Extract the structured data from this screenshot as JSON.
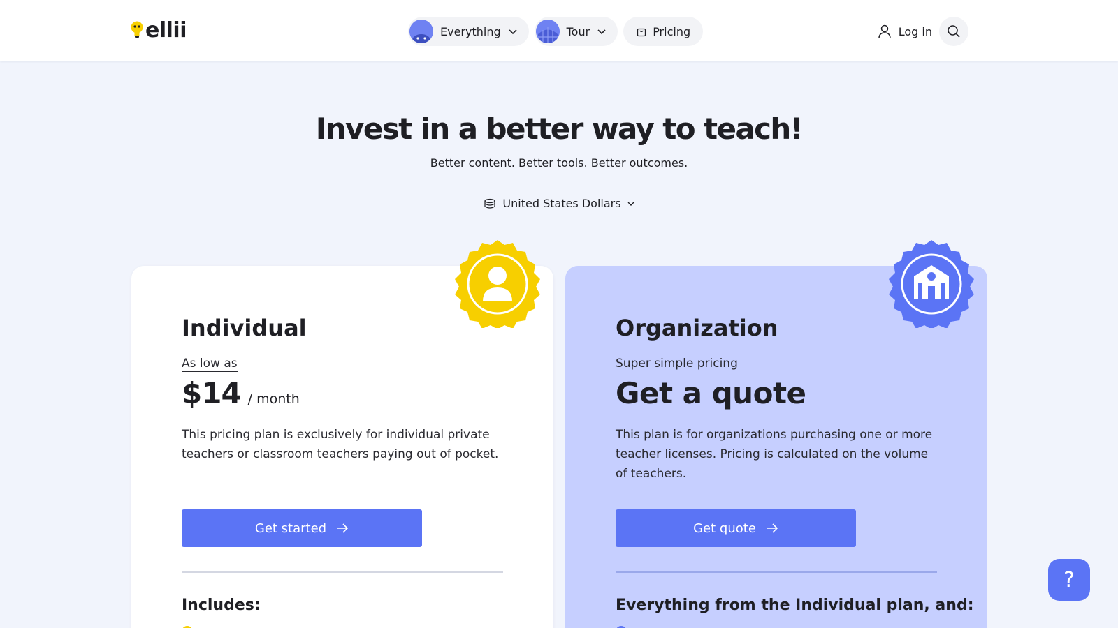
{
  "header": {
    "logo_text": "ellii",
    "nav": [
      {
        "label": "Everything"
      },
      {
        "label": "Tour"
      },
      {
        "label": "Pricing"
      }
    ],
    "login_label": "Log in"
  },
  "hero": {
    "title": "Invest in a better way to teach!",
    "subtitle": "Better content. Better tools. Better outcomes.",
    "currency": "United States Dollars"
  },
  "plans": [
    {
      "name": "Individual",
      "pre_label": "As low as",
      "price": "$14",
      "price_unit": "/ month",
      "description": "This pricing plan is exclusively for individual private teachers or classroom teachers paying out of pocket.",
      "cta": "Get started",
      "includes_heading": "Includes:"
    },
    {
      "name": "Organization",
      "pre_label": "Super simple pricing",
      "price": "Get a quote",
      "description": "This plan is for organizations purchasing one or more teacher licenses. Pricing is calculated on the volume of teachers.",
      "cta": "Get quote",
      "includes_heading": "Everything from the Individual plan, and:"
    }
  ],
  "help_label": "?",
  "colors": {
    "accent": "#5b74f5",
    "badge_yellow": "#f7cf00",
    "badge_blue": "#5b74f5",
    "org_card": "#c6cfff",
    "background": "#f1f4fc"
  },
  "icons": {
    "logo": "lightbulb-icon",
    "everything": "avatar-icon",
    "tour": "globe-icon",
    "pricing": "shopping-bag-icon",
    "login": "user-icon",
    "search": "search-icon",
    "currency": "coins-icon",
    "individual_badge": "person-badge-icon",
    "organization_badge": "school-badge-icon",
    "cta": "arrow-right-icon"
  }
}
